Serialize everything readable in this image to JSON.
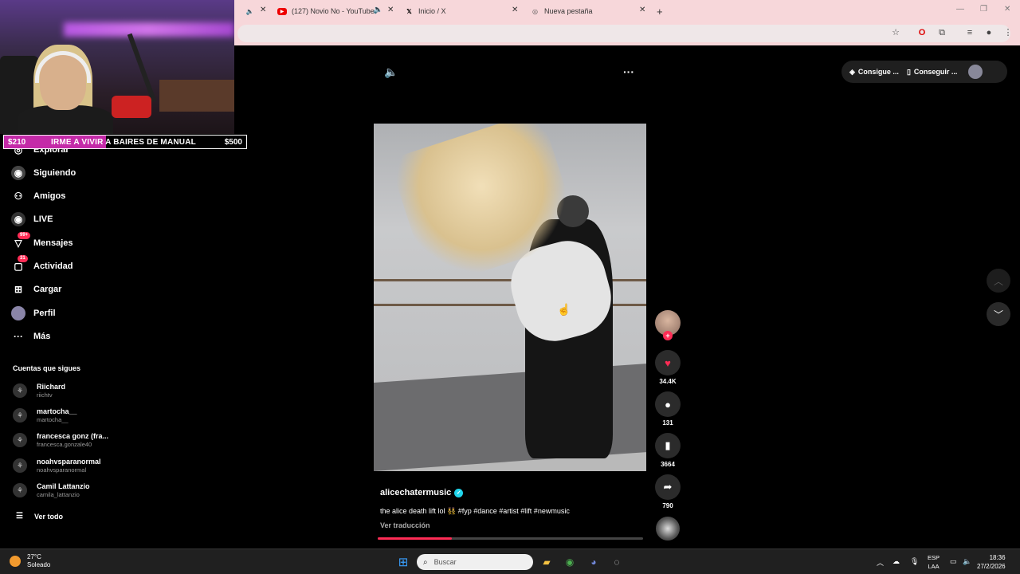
{
  "browser": {
    "tabs": [
      {
        "title": "(127) Novio No - YouTube"
      },
      {
        "title": "Inicio / X"
      },
      {
        "title": "Nueva pestaña"
      }
    ]
  },
  "stream_overlay": {
    "goal_left": "$210",
    "goal_text": "IRME A VIVIR A BAIRES DE MANUAL",
    "goal_right": "$500",
    "goal_progress": 0.42
  },
  "sidebar": {
    "items": [
      {
        "label": "Explorar",
        "icon": "compass-icon",
        "glyph": "◎"
      },
      {
        "label": "Siguiendo",
        "icon": "following-icon",
        "glyph": "◉"
      },
      {
        "label": "Amigos",
        "icon": "friends-icon",
        "glyph": "⚇"
      },
      {
        "label": "LIVE",
        "icon": "live-icon",
        "glyph": "◉"
      },
      {
        "label": "Mensajes",
        "icon": "messages-icon",
        "glyph": "▽",
        "badge": "99+"
      },
      {
        "label": "Actividad",
        "icon": "activity-icon",
        "glyph": "▢",
        "badge": "31"
      },
      {
        "label": "Cargar",
        "icon": "upload-icon",
        "glyph": "⊞"
      },
      {
        "label": "Perfil",
        "icon": "profile-icon",
        "glyph": "●"
      },
      {
        "label": "Más",
        "icon": "more-icon",
        "glyph": "···"
      }
    ],
    "following_title": "Cuentas que sigues",
    "following": [
      {
        "name": "Riichard",
        "handle": "riichtv"
      },
      {
        "name": "martocha__",
        "handle": "martocha__"
      },
      {
        "name": "francesca gonz (fra...",
        "handle": "francesca.gonzale40"
      },
      {
        "name": "noahvsparanormal",
        "handle": "noahvsparanormal"
      },
      {
        "name": "Camil Lattanzio",
        "handle": "camila_lattanzio"
      }
    ],
    "see_all": "Ver todo"
  },
  "topbar": {
    "get_app": "Consigue ...",
    "get_coins": "Conseguir ..."
  },
  "video": {
    "author": "alicechatermusic",
    "caption": "the alice death lift lol 👯 #fyp #dance #artist #lift #newmusic",
    "translate": "Ver traducción",
    "progress": 0.28,
    "likes": "34.4K",
    "comments": "131",
    "saves": "3664",
    "shares": "790"
  },
  "taskbar": {
    "temp": "27°C",
    "weather": "Soleado",
    "search_placeholder": "Buscar",
    "lang1": "ESP",
    "lang2": "LAA",
    "time": "18:36",
    "date": "27/2/2026"
  }
}
